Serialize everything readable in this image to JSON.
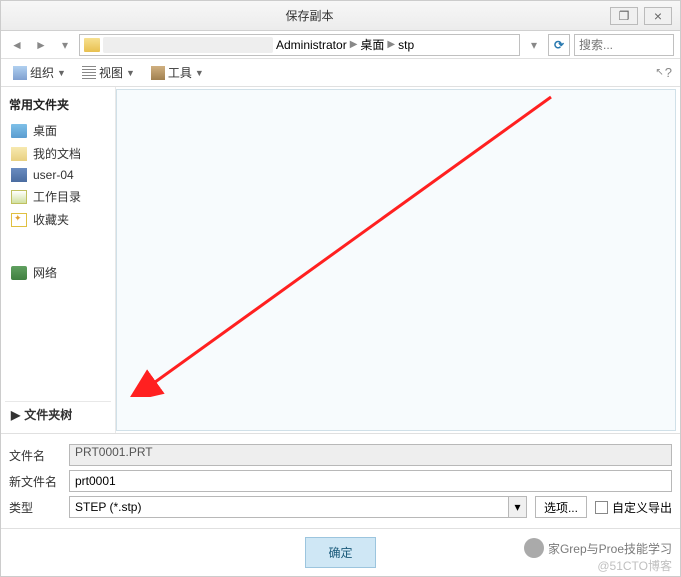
{
  "title": "保存副本",
  "breadcrumb": {
    "seg1": "Administrator",
    "seg2": "桌面",
    "seg3": "stp"
  },
  "search_placeholder": "搜索...",
  "toolbar": {
    "organize": "组织",
    "view": "视图",
    "tools": "工具"
  },
  "sidebar": {
    "header": "常用文件夹",
    "desktop": "桌面",
    "mydocs": "我的文档",
    "user": "user-04",
    "workdir": "工作目录",
    "favorites": "收藏夹",
    "network": "网络",
    "foldertree": "文件夹树"
  },
  "form": {
    "filename_label": "文件名",
    "filename_value": "PRT0001.PRT",
    "newfilename_label": "新文件名",
    "newfilename_value": "prt0001",
    "type_label": "类型",
    "type_value": "STEP (*.stp)",
    "options_btn": "选项...",
    "custom_export": "自定义导出"
  },
  "ok_button": "确定",
  "watermark": "家Grep与Proe技能学习",
  "watermark2": "@51CTO博客"
}
